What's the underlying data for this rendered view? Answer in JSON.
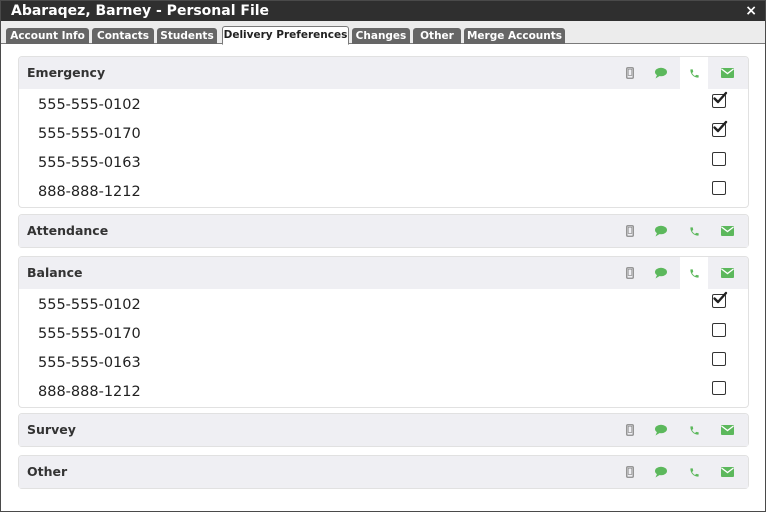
{
  "window": {
    "title": "Abaraqez, Barney - Personal File",
    "close_label": "×"
  },
  "tabs": [
    {
      "label": "Account Info",
      "active": false
    },
    {
      "label": "Contacts",
      "active": false
    },
    {
      "label": "Students",
      "active": false
    },
    {
      "label": "Delivery Preferences",
      "active": true
    },
    {
      "label": "Changes",
      "active": false
    },
    {
      "label": "Other",
      "active": false
    },
    {
      "label": "Merge Accounts",
      "active": false
    }
  ],
  "channel_icons": [
    "mobile-icon",
    "sms-chat-icon",
    "phone-icon",
    "email-icon"
  ],
  "colors": {
    "accent_green": "#5cb85c",
    "mobile_gray": "#8a8a8a",
    "title_bar": "#2f2f2f",
    "tab_inactive": "#666666"
  },
  "sections": [
    {
      "name": "Emergency",
      "expanded": true,
      "active_channel": "phone",
      "entries": [
        {
          "number": "555-555-0102",
          "checked": true
        },
        {
          "number": "555-555-0170",
          "checked": true
        },
        {
          "number": "555-555-0163",
          "checked": false
        },
        {
          "number": "888-888-1212",
          "checked": false
        }
      ]
    },
    {
      "name": "Attendance",
      "expanded": false
    },
    {
      "name": "Balance",
      "expanded": true,
      "active_channel": "phone",
      "entries": [
        {
          "number": "555-555-0102",
          "checked": true
        },
        {
          "number": "555-555-0170",
          "checked": false
        },
        {
          "number": "555-555-0163",
          "checked": false
        },
        {
          "number": "888-888-1212",
          "checked": false
        }
      ]
    },
    {
      "name": "Survey",
      "expanded": false
    },
    {
      "name": "Other",
      "expanded": false
    }
  ]
}
